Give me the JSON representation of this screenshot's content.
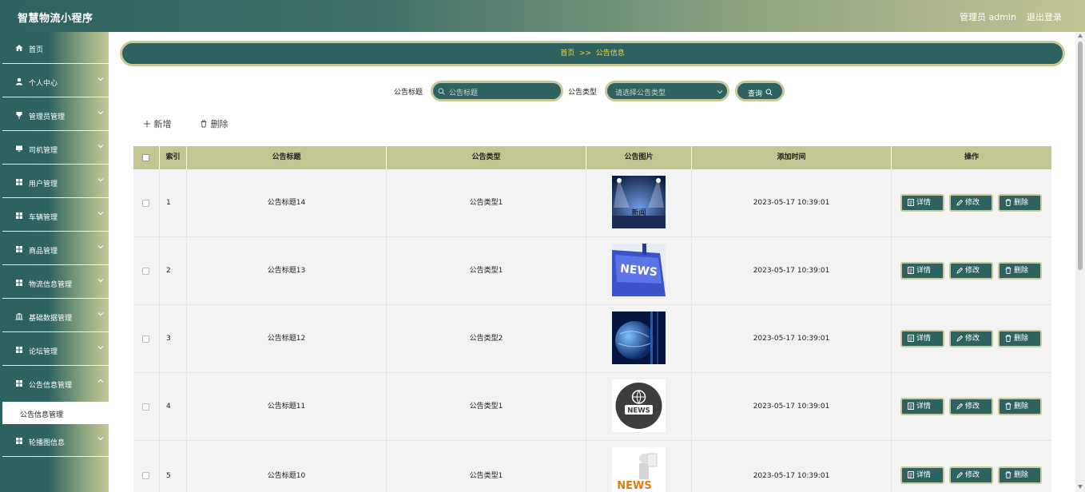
{
  "header": {
    "title": "智慧物流小程序",
    "user": "管理员 admin",
    "logout": "退出登录"
  },
  "sidebar": {
    "items": [
      {
        "label": "首页",
        "icon": "home-icon"
      },
      {
        "label": "个人中心",
        "icon": "person-icon"
      },
      {
        "label": "管理员管理",
        "icon": "pin-icon"
      },
      {
        "label": "司机管理",
        "icon": "monitor-icon"
      },
      {
        "label": "用户管理",
        "icon": "grid-icon"
      },
      {
        "label": "车辆管理",
        "icon": "grid-icon"
      },
      {
        "label": "商品管理",
        "icon": "grid-icon"
      },
      {
        "label": "物流信息管理",
        "icon": "grid-icon"
      },
      {
        "label": "基础数据管理",
        "icon": "bank-icon"
      },
      {
        "label": "论坛管理",
        "icon": "grid-icon"
      },
      {
        "label": "公告信息管理",
        "icon": "grid-icon"
      },
      {
        "label": "轮播图信息",
        "icon": "grid-icon"
      }
    ],
    "active_sub": "公告信息管理"
  },
  "breadcrumb": {
    "home": "首页",
    "sep": ">>",
    "current": "公告信息"
  },
  "search": {
    "title_label": "公告标题",
    "title_placeholder": "公告标题",
    "type_label": "公告类型",
    "type_placeholder": "请选择公告类型",
    "query_label": "查询"
  },
  "toolbar": {
    "add_label": "新增",
    "delete_label": "删除"
  },
  "table": {
    "headers": [
      "",
      "索引",
      "公告标题",
      "公告类型",
      "公告图片",
      "添加时间",
      "操作"
    ],
    "actions": {
      "detail": "详情",
      "edit": "修改",
      "delete": "删除"
    },
    "rows": [
      {
        "index": "1",
        "title": "公告标题14",
        "type": "公告类型1",
        "image": "spotlight-news",
        "image_text": "新闻",
        "time": "2023-05-17 10:39:01"
      },
      {
        "index": "2",
        "title": "公告标题13",
        "type": "公告类型1",
        "image": "news-key",
        "image_text": "NEWS",
        "time": "2023-05-17 10:39:01"
      },
      {
        "index": "3",
        "title": "公告标题12",
        "type": "公告类型2",
        "image": "globe",
        "image_text": "",
        "time": "2023-05-17 10:39:01"
      },
      {
        "index": "4",
        "title": "公告标题11",
        "type": "公告类型1",
        "image": "news-globe-icon",
        "image_text": "NEWS",
        "time": "2023-05-17 10:39:01"
      },
      {
        "index": "5",
        "title": "公告标题10",
        "type": "公告类型1",
        "image": "news-figure",
        "image_text": "NEWS",
        "time": "2023-05-17 10:39:01"
      }
    ]
  },
  "colors": {
    "primary": "#2e6260",
    "accent": "#c9c998",
    "header_bg": "#c3c593",
    "breadcrumb_text": "#f3d43a"
  }
}
